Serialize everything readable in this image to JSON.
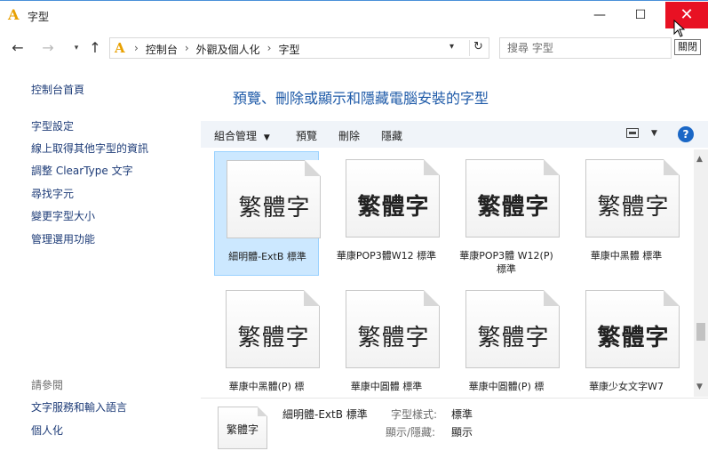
{
  "window": {
    "title": "字型",
    "minimize": "—",
    "maximize": "☐",
    "close": "✕",
    "close_tooltip": "關閉"
  },
  "nav": {
    "back": "←",
    "forward": "→",
    "recent": "▾",
    "up": "↑",
    "breadcrumbs": [
      "控制台",
      "外觀及個人化",
      "字型"
    ],
    "separator": "›",
    "address_dropdown": "▾",
    "refresh": "↻",
    "search_placeholder": "搜尋 字型"
  },
  "sidebar": {
    "home": "控制台首頁",
    "links": [
      "字型設定",
      "線上取得其他字型的資訊",
      "調整 ClearType 文字",
      "尋找字元",
      "變更字型大小",
      "管理選用功能"
    ],
    "see_also_header": "請參閱",
    "see_also": [
      "文字服務和輸入語言",
      "個人化"
    ]
  },
  "main": {
    "heading": "預覽、刪除或顯示和隱藏電腦安裝的字型",
    "toolbar": {
      "organize": "組合管理",
      "organize_drop": "▼",
      "preview": "預覽",
      "delete": "刪除",
      "hide": "隱藏",
      "view_drop": "▼",
      "help": "?"
    }
  },
  "fonts": [
    {
      "sample": "繁體字",
      "label": "細明體-ExtB 標準",
      "style": "thin",
      "selected": true
    },
    {
      "sample": "繁體字",
      "label": "華康POP3體W12 標準",
      "style": "bold",
      "selected": false
    },
    {
      "sample": "繁體字",
      "label": "華康POP3體 W12(P) 標準",
      "style": "bold",
      "selected": false
    },
    {
      "sample": "繁體字",
      "label": "華康中黑體 標準",
      "style": "plain",
      "selected": false
    },
    {
      "sample": "繁體字",
      "label": "華康中黑體(P) 標",
      "style": "plain",
      "selected": false
    },
    {
      "sample": "繁體字",
      "label": "華康中圓體 標準",
      "style": "plain",
      "selected": false
    },
    {
      "sample": "繁體字",
      "label": "華康中圓體(P) 標",
      "style": "plain",
      "selected": false
    },
    {
      "sample": "繁體字",
      "label": "華康少女文字W7",
      "style": "bold",
      "selected": false
    }
  ],
  "scrollbar": {
    "up": "▲",
    "down": "▼"
  },
  "details": {
    "sample": "繁體字",
    "name": "細明體-ExtB 標準",
    "style_label": "字型樣式:",
    "style_value": "標準",
    "visibility_label": "顯示/隱藏:",
    "visibility_value": "顯示"
  },
  "colors": {
    "accent": "#1e5aa8",
    "link": "#1e3c78",
    "close_red": "#e81123",
    "selection": "#cce8ff"
  }
}
